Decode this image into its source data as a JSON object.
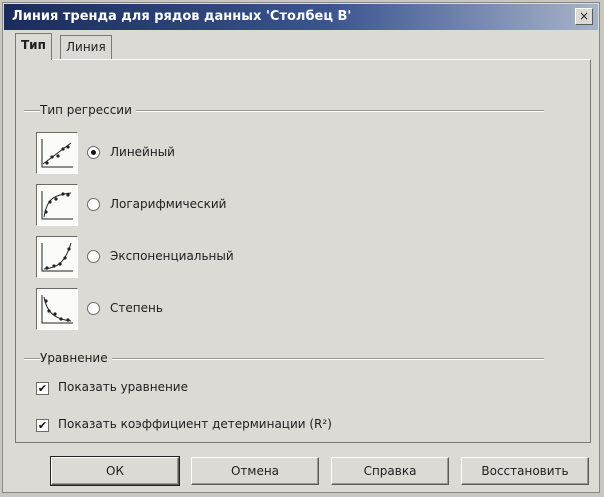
{
  "window": {
    "title": "Линия тренда для рядов данных 'Столбец B'",
    "close_glyph": "×"
  },
  "tabs": [
    {
      "label": "Тип",
      "active": true
    },
    {
      "label": "Линия",
      "active": false
    }
  ],
  "regression_group": {
    "label": "Тип регрессии",
    "options": [
      {
        "label": "Линейный",
        "selected": true,
        "icon": "linear-trend-icon"
      },
      {
        "label": "Логарифмический",
        "selected": false,
        "icon": "logarithmic-trend-icon"
      },
      {
        "label": "Экспоненциальный",
        "selected": false,
        "icon": "exponential-trend-icon"
      },
      {
        "label": "Степень",
        "selected": false,
        "icon": "power-trend-icon"
      }
    ]
  },
  "equation_group": {
    "label": "Уравнение",
    "show_equation": {
      "label": "Показать уравнение",
      "checked": true
    },
    "show_r2": {
      "label": "Показать коэффициент детерминации (R²)",
      "checked": true
    },
    "check_glyph": "✔"
  },
  "buttons": {
    "ok": "ОК",
    "cancel": "Отмена",
    "help": "Справка",
    "reset": "Восстановить"
  }
}
